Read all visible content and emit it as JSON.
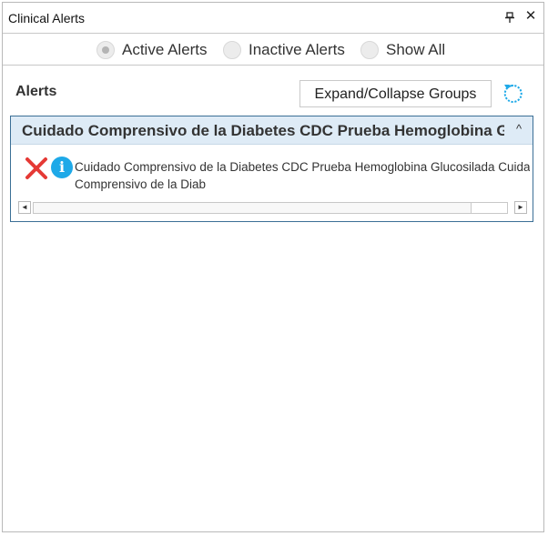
{
  "window": {
    "title": "Clinical Alerts",
    "pin_icon": "pin-icon",
    "close_icon": "close-icon",
    "close_glyph": "✕"
  },
  "filters": [
    {
      "label": "Active Alerts",
      "checked": true
    },
    {
      "label": "Inactive Alerts",
      "checked": false
    },
    {
      "label": "Show All",
      "checked": false
    }
  ],
  "alerts_panel": {
    "heading": "Alerts",
    "expand_button_label": "Expand/Collapse Groups",
    "refresh_icon": "refresh-icon"
  },
  "group": {
    "title": "Cuidado Comprensivo de la Diabetes CDC Prueba Hemoglobina Glucosilada",
    "collapse_glyph": "^",
    "items": [
      {
        "status_icon": "red-x-icon",
        "info_icon": "info-icon",
        "info_glyph": "i",
        "text_line1": "Cuidado Comprensivo de la Diabetes CDC Prueba Hemoglobina Glucosilada Cuidado",
        "text_line2": "Comprensivo de la Diab"
      }
    ],
    "scrollbar": {
      "left_glyph": "◄",
      "right_glyph": "►"
    }
  },
  "colors": {
    "accent": "#1ea9e8",
    "error": "#e53935",
    "group_border": "#3b6f96",
    "group_header_bg": "#deebf6"
  }
}
